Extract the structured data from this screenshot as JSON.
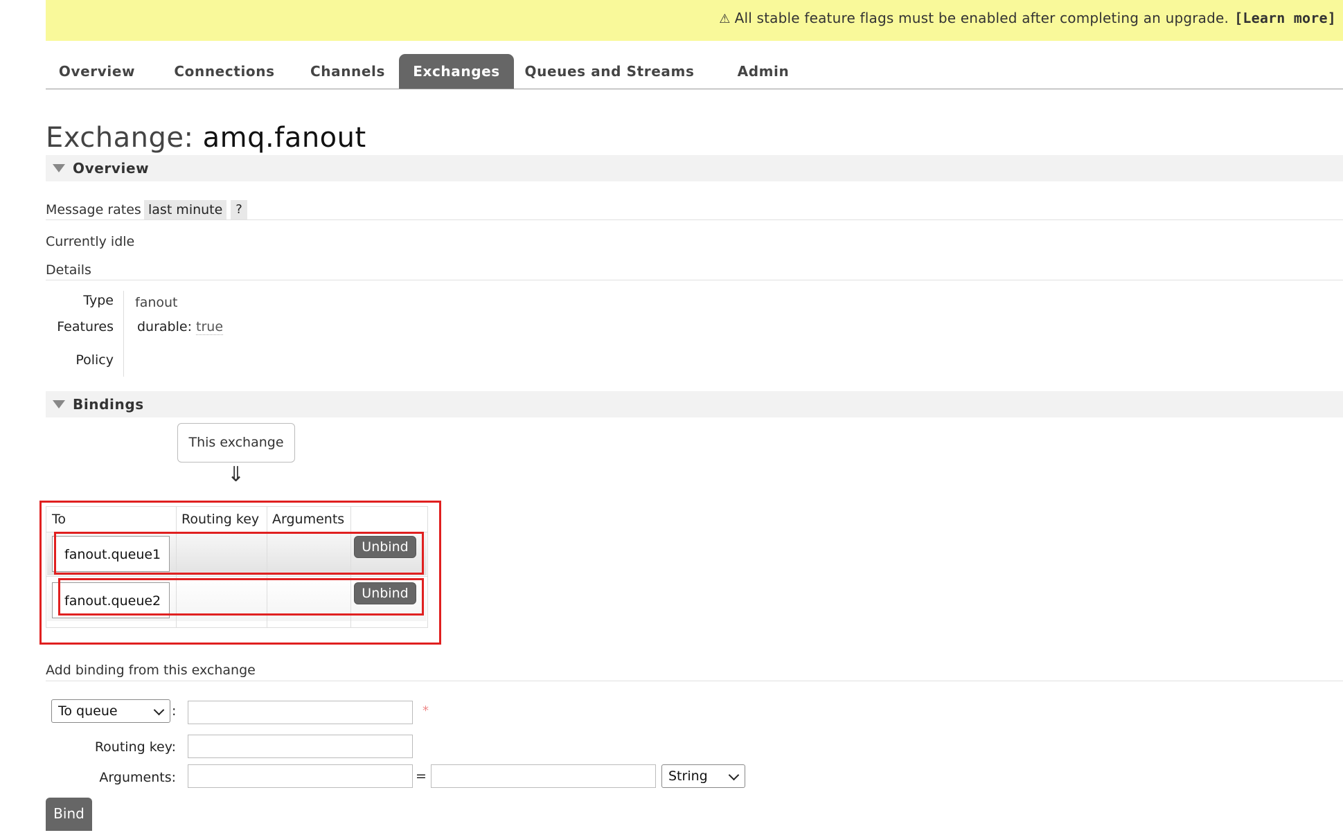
{
  "notice": {
    "warning_icon": "⚠",
    "message": "All stable feature flags must be enabled after completing an upgrade.",
    "link": "[Learn more]"
  },
  "tabs": [
    {
      "label": "Overview"
    },
    {
      "label": "Connections"
    },
    {
      "label": "Channels"
    },
    {
      "label": "Exchanges",
      "active": true
    },
    {
      "label": "Queues and Streams"
    },
    {
      "label": "Admin"
    }
  ],
  "title": {
    "prefix": "Exchange:",
    "name": "amq.fanout"
  },
  "overview": {
    "section_label": "Overview",
    "message_rates_label": "Message rates",
    "message_rates_value": "last minute",
    "help": "?",
    "status": "Currently idle",
    "details_label": "Details",
    "details": {
      "type_label": "Type",
      "type_value": "fanout",
      "features_label": "Features",
      "feature_key": "durable:",
      "feature_value": "true",
      "policy_label": "Policy",
      "policy_value": ""
    }
  },
  "bindings": {
    "section_label": "Bindings",
    "source_label": "This exchange",
    "arrow": "⇓",
    "columns": [
      "To",
      "Routing key",
      "Arguments"
    ],
    "rows": [
      {
        "to": "fanout.queue1",
        "routing_key": "",
        "arguments": "",
        "action": "Unbind"
      },
      {
        "to": "fanout.queue2",
        "routing_key": "",
        "arguments": "",
        "action": "Unbind"
      }
    ]
  },
  "add_binding": {
    "heading": "Add binding from this exchange",
    "destination_select": "To queue",
    "colon": ":",
    "required_mark": "*",
    "routing_key_label": "Routing key:",
    "arguments_label": "Arguments:",
    "equals": "=",
    "type_select": "String",
    "submit": "Bind"
  },
  "colors": {
    "notice_bg": "#f9f99a",
    "active_tab_bg": "#666666",
    "highlight_border": "#e02020"
  }
}
